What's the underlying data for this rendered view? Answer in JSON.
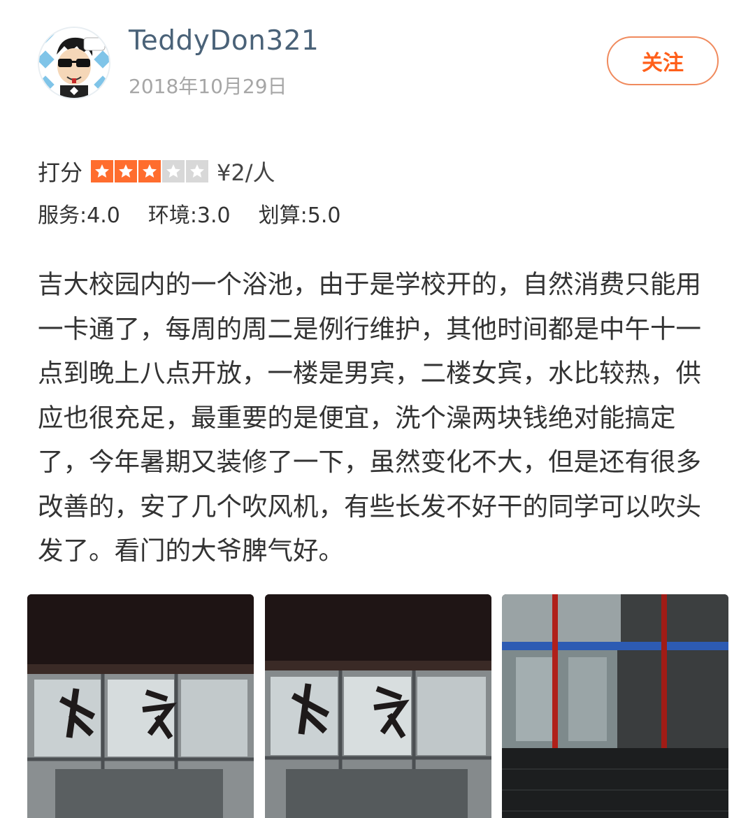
{
  "user": {
    "name": "TeddyDon321",
    "date": "2018年10月29日"
  },
  "actions": {
    "follow_label": "关注"
  },
  "rating": {
    "label": "打分",
    "stars": 3,
    "max_stars": 5,
    "price": "¥2/人",
    "subscores": [
      {
        "text": "服务:4.0"
      },
      {
        "text": "环境:3.0"
      },
      {
        "text": "划算:5.0"
      }
    ]
  },
  "review": {
    "text": "吉大校园内的一个浴池，由于是学校开的，自然消费只能用一卡通了，每周的周二是例行维护，其他时间都是中午十一点到晚上八点开放，一楼是男宾，二楼女宾，水比较热，供应也很充足，最重要的是便宜，洗个澡两块钱绝对能搞定了，今年暑期又装修了一下，虽然变化不大，但是还有很多改善的，安了几个吹风机，有些长发不好干的同学可以吹头发了。看门的大爷脾气好。"
  },
  "colors": {
    "accent": "#ff6d2e",
    "username": "#4a6278",
    "muted": "#a6a6a6"
  }
}
